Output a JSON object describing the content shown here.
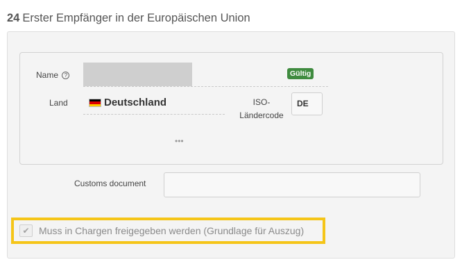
{
  "section": {
    "number": "24",
    "title": "Erster Empfänger in der Europäischen Union"
  },
  "fields": {
    "name_label": "Name",
    "name_help_icon": "question-circle-icon",
    "status_badge": "Gültig",
    "country_label": "Land",
    "country_value": "Deutschland",
    "country_flag": "flag-germany-icon",
    "iso_label_line1": "ISO-",
    "iso_label_line2": "Ländercode",
    "iso_value": "DE",
    "more_indicator": "•••"
  },
  "customs": {
    "label": "Customs document",
    "value": ""
  },
  "release": {
    "checked": true,
    "label": "Muss in Chargen freigegeben werden (Grundlage für Auszug)"
  },
  "colors": {
    "badge_green": "#3f8b3f",
    "highlight_yellow": "#f5c518",
    "flag": [
      "#000000",
      "#dd0000",
      "#ffce00"
    ]
  }
}
